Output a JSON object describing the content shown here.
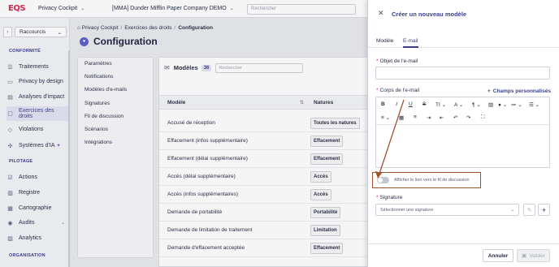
{
  "topbar": {
    "logo": "EQS",
    "app": "Privacy Cockpit",
    "company": "[MMA] Dunder Mifflin Paper Company DEMO",
    "search_placeholder": "Rechercher"
  },
  "sidebar": {
    "shortcuts_label": "Raccourcis",
    "sections": [
      {
        "title": "CONFORMITÉ",
        "items": [
          {
            "label": "Traitements",
            "icon": "list-icon"
          },
          {
            "label": "Privacy by design",
            "icon": "folder-icon"
          },
          {
            "label": "Analyses d'impact",
            "icon": "chart-icon"
          },
          {
            "label": "Exercices des droits",
            "icon": "chat-icon",
            "active": true
          },
          {
            "label": "Violations",
            "icon": "shield-icon"
          },
          {
            "label": "Systèmes d'IA",
            "icon": "ai-icon"
          }
        ]
      },
      {
        "title": "PILOTAGE",
        "items": [
          {
            "label": "Actions",
            "icon": "check-icon"
          },
          {
            "label": "Registre",
            "icon": "book-icon"
          },
          {
            "label": "Cartographie",
            "icon": "map-icon"
          },
          {
            "label": "Audits",
            "icon": "audit-icon"
          },
          {
            "label": "Analytics",
            "icon": "analytics-icon"
          }
        ]
      },
      {
        "title": "ORGANISATION",
        "items": []
      }
    ]
  },
  "breadcrumb": [
    "Privacy Cockpit",
    "Exercices des droits",
    "Configuration"
  ],
  "page_title": "Configuration",
  "subnav": [
    "Paramètres",
    "Notifications",
    "Modèles d'e-mails",
    "Signatures",
    "Fil de discussion",
    "Scénarios",
    "Intégrations"
  ],
  "panel": {
    "title": "Modèles",
    "count": "36",
    "search_placeholder": "Rechercher",
    "columns": [
      "Modèle",
      "Natures"
    ],
    "rows": [
      {
        "name": "Accusé de réception",
        "nature": "Toutes les natures"
      },
      {
        "name": "Effacement (infos supplémentaire)",
        "nature": "Effacement"
      },
      {
        "name": "Effacement (délai supplémentaire)",
        "nature": "Effacement"
      },
      {
        "name": "Accès (délai supplémentaire)",
        "nature": "Accès"
      },
      {
        "name": "Accès (infos supplémentaires)",
        "nature": "Accès"
      },
      {
        "name": "Demande de portabilité",
        "nature": "Portabilité"
      },
      {
        "name": "Demande de limitation de traitement",
        "nature": "Limitation"
      },
      {
        "name": "Demande d'effacement acceptée",
        "nature": "Effacement"
      }
    ]
  },
  "drawer": {
    "title": "Créer un nouveau modèle",
    "tabs": [
      "Modèle",
      "E-mail"
    ],
    "active_tab": "E-mail",
    "subject_label": "Objet de l'e-mail",
    "body_label": "Corps de l'e-mail",
    "custom_fields": "Champs personnalisés",
    "toggle_label": "Afficher le lien vers le fil de discussion",
    "toggle_on": false,
    "signature_label": "Signature",
    "signature_placeholder": "Sélectionner une signature",
    "cancel": "Annuler",
    "validate": "Valider"
  },
  "toolbar": {
    "bold": "B",
    "italic": "I",
    "underline": "U",
    "strike": "S",
    "text_size": "TI",
    "font": "A",
    "paragraph": "¶"
  },
  "colors": {
    "accent": "#3b3f8a",
    "brand": "#e0234e",
    "highlight_box": "#a0522d"
  }
}
